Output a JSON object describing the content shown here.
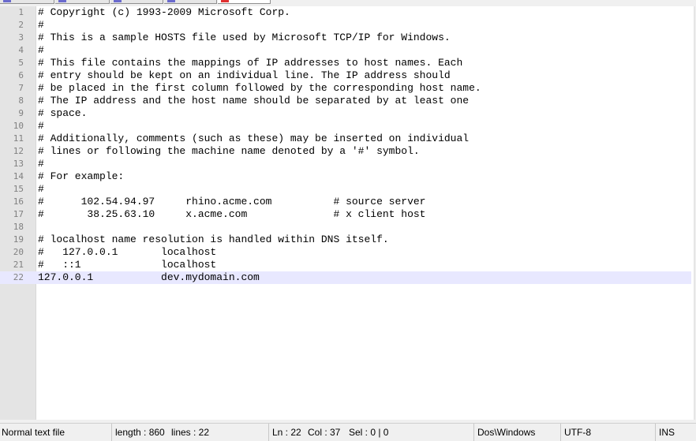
{
  "colors": {
    "editor_bg": "#ffffff",
    "gutter_bg": "#e4e4e4",
    "current_line_bg": "#e8e8ff",
    "line_number": "#808080",
    "active_tab_accent": "#e03030"
  },
  "editor": {
    "current_line": 22,
    "lines": [
      {
        "n": "1",
        "text": "# Copyright (c) 1993-2009 Microsoft Corp."
      },
      {
        "n": "2",
        "text": "#"
      },
      {
        "n": "3",
        "text": "# This is a sample HOSTS file used by Microsoft TCP/IP for Windows."
      },
      {
        "n": "4",
        "text": "#"
      },
      {
        "n": "5",
        "text": "# This file contains the mappings of IP addresses to host names. Each"
      },
      {
        "n": "6",
        "text": "# entry should be kept on an individual line. The IP address should"
      },
      {
        "n": "7",
        "text": "# be placed in the first column followed by the corresponding host name."
      },
      {
        "n": "8",
        "text": "# The IP address and the host name should be separated by at least one"
      },
      {
        "n": "9",
        "text": "# space."
      },
      {
        "n": "10",
        "text": "#"
      },
      {
        "n": "11",
        "text": "# Additionally, comments (such as these) may be inserted on individual"
      },
      {
        "n": "12",
        "text": "# lines or following the machine name denoted by a '#' symbol."
      },
      {
        "n": "13",
        "text": "#"
      },
      {
        "n": "14",
        "text": "# For example:"
      },
      {
        "n": "15",
        "text": "#"
      },
      {
        "n": "16",
        "text": "#      102.54.94.97     rhino.acme.com          # source server"
      },
      {
        "n": "17",
        "text": "#       38.25.63.10     x.acme.com              # x client host"
      },
      {
        "n": "18",
        "text": ""
      },
      {
        "n": "19",
        "text": "# localhost name resolution is handled within DNS itself."
      },
      {
        "n": "20",
        "text": "#   127.0.0.1       localhost"
      },
      {
        "n": "21",
        "text": "#   ::1             localhost"
      },
      {
        "n": "22",
        "text": "127.0.0.1           dev.mydomain.com"
      }
    ]
  },
  "statusbar": {
    "file_type": "Normal text file",
    "length": "length : 860",
    "lines": "lines : 22",
    "ln": "Ln : 22",
    "col": "Col : 37",
    "sel": "Sel : 0 | 0",
    "eol": "Dos\\Windows",
    "encoding": "UTF-8",
    "mode": "INS"
  }
}
